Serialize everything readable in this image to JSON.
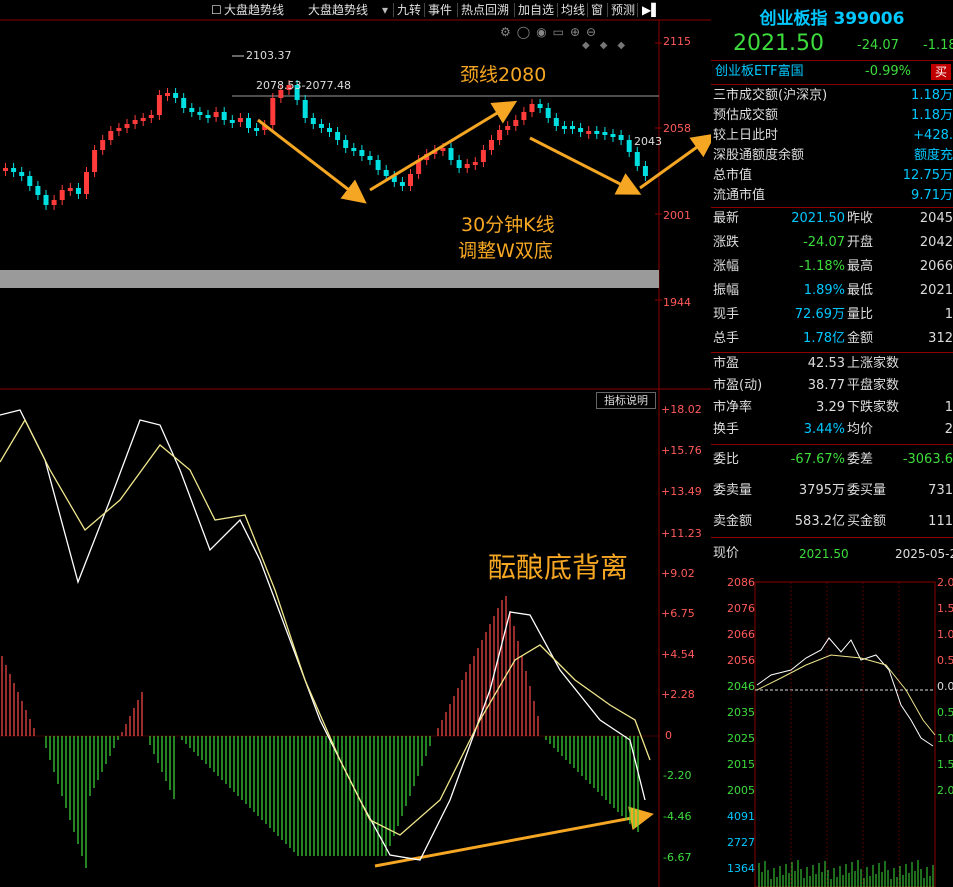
{
  "toolbar": {
    "checkbox_label": "大盘趋势线",
    "select_value": "大盘趋势线",
    "buttons": [
      "九转",
      "事件",
      "热点回溯",
      "加自选",
      "均线",
      "窗",
      "预测"
    ]
  },
  "kline": {
    "price_ticks": [
      "2115",
      "2058",
      "2001",
      "1944"
    ],
    "high_marker": "2103.37",
    "range_label": "2078.53-2077.48",
    "last_tag": "2043"
  },
  "indicator": {
    "explain_button": "指标说明",
    "ticks": [
      "+18.02",
      "+15.76",
      "+13.49",
      "+11.23",
      "+9.02",
      "+6.75",
      "+4.54",
      "+2.28",
      "0",
      "-2.20",
      "-4.46",
      "-6.67"
    ]
  },
  "annotations": {
    "neckline": "颈线2080",
    "w_bottom_line1": "30分钟K线",
    "w_bottom_line2": "调整W双底",
    "divergence": "酝酿底背离"
  },
  "quote": {
    "title": "创业板指 399006",
    "price": "2021.50",
    "change": "-24.07",
    "change_pct": "-1.18",
    "etf_name": "创业板ETF富国",
    "etf_pct": "-0.99%",
    "etf_button": "买",
    "rows": [
      {
        "label": "三市成交额(沪深京)",
        "value": "1.18万"
      },
      {
        "label": "预估成交额",
        "value": "1.18万"
      },
      {
        "label": "较上日此时",
        "value": "+428."
      },
      {
        "label": "深股通额度余额",
        "value": "额度充"
      },
      {
        "label": "总市值",
        "value": "12.75万"
      },
      {
        "label": "流通市值",
        "value": "9.71万"
      }
    ],
    "grid": [
      {
        "l1": "最新",
        "v1": "2021.50",
        "l2": "昨收",
        "v2": "2045"
      },
      {
        "l1": "涨跌",
        "v1": "-24.07",
        "l2": "开盘",
        "v2": "2042"
      },
      {
        "l1": "涨幅",
        "v1": "-1.18%",
        "l2": "最高",
        "v2": "2066"
      },
      {
        "l1": "振幅",
        "v1": "1.89%",
        "l2": "最低",
        "v2": "2021"
      },
      {
        "l1": "现手",
        "v1": "72.69万",
        "l2": "量比",
        "v2": "1"
      },
      {
        "l1": "总手",
        "v1": "1.78亿",
        "l2": "金额",
        "v2": "312"
      }
    ],
    "grid2": [
      {
        "l1": "市盈",
        "v1": "42.53",
        "l2": "上涨家数",
        "v2": ""
      },
      {
        "l1": "市盈(动)",
        "v1": "38.77",
        "l2": "平盘家数",
        "v2": ""
      },
      {
        "l1": "市净率",
        "v1": "3.29",
        "l2": "下跌家数",
        "v2": "1"
      },
      {
        "l1": "换手",
        "v1": "3.44%",
        "l2": "均价",
        "v2": "2"
      }
    ],
    "grid3": [
      {
        "l1": "委比",
        "v1": "-67.67%",
        "l2": "委差",
        "v2": "-3063.6"
      },
      {
        "l1": "委卖量",
        "v1": "3795万",
        "l2": "委买量",
        "v2": "731"
      },
      {
        "l1": "卖金额",
        "v1": "583.2亿",
        "l2": "买金额",
        "v2": "111"
      }
    ],
    "mini_header": {
      "label": "现价",
      "price": "2021.50",
      "date": "2025-05-2"
    },
    "mini_left_ticks": [
      "2086",
      "2076",
      "2066",
      "2056",
      "2046",
      "2035",
      "2025",
      "2015",
      "2005",
      "4091",
      "2727",
      "1364"
    ],
    "mini_right_ticks": [
      "2.0",
      "1.5",
      "1.0",
      "0.5",
      "0.0",
      "0.5",
      "1.0",
      "1.5",
      "2.0"
    ]
  },
  "colors": {
    "up": "#ff3b3b",
    "down": "#00e0e0",
    "green": "#3ddc3d",
    "orange": "#f5a623",
    "axis": "#8b0000"
  }
}
